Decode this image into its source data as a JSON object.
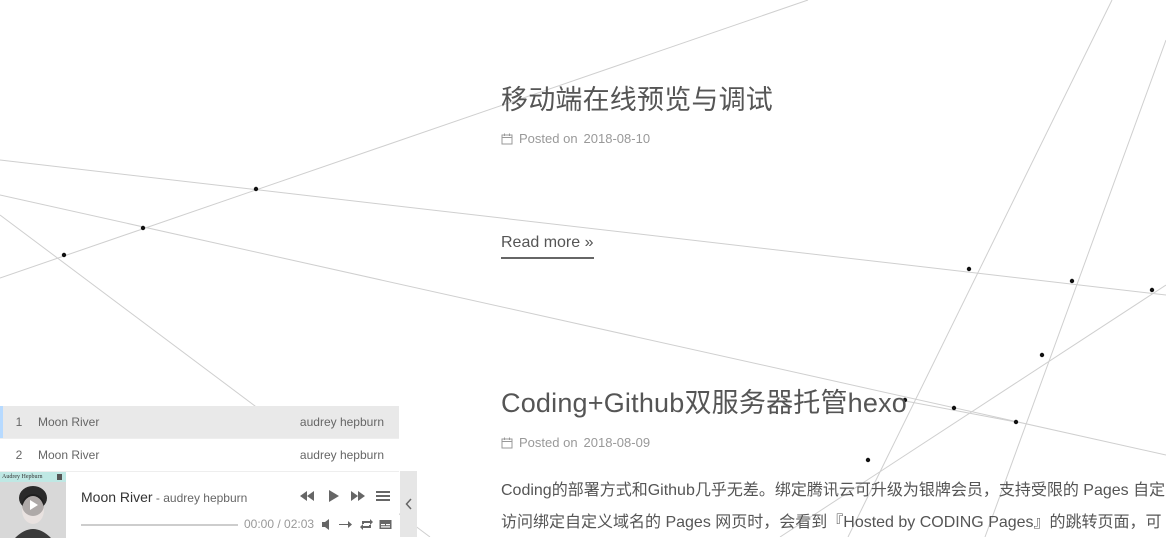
{
  "posts": [
    {
      "title": "移动端在线预览与调试",
      "meta_label": "Posted on",
      "date": "2018-08-10",
      "read_more": "Read more »"
    },
    {
      "title": "Coding+Github双服务器托管hexo",
      "meta_label": "Posted on",
      "date": "2018-08-09",
      "excerpt_lines": [
        "Coding的部署方式和Github几乎无差。绑定腾讯云可升级为银牌会员，支持受限的 Pages 自定",
        "访问绑定自定义域名的 Pages 网页时，会看到『Hosted by CODING Pages』的跳转页面，可"
      ]
    }
  ],
  "player": {
    "playlist": [
      {
        "index": "1",
        "title": "Moon River",
        "author": "audrey hepburn"
      },
      {
        "index": "2",
        "title": "Moon River",
        "author": "audrey hepburn"
      }
    ],
    "now_playing": {
      "title": "Moon River",
      "artist": " - audrey hepburn"
    },
    "cover_caption": "Audrey Hepburn",
    "time": "00:00 / 02:03",
    "progress": 0,
    "icons": [
      "skip-back-icon",
      "play-icon",
      "skip-forward-icon",
      "menu-icon",
      "volume-icon",
      "order-icon",
      "loop-icon",
      "lyrics-icon",
      "chevron-left-icon"
    ]
  },
  "colors": {
    "line": "#cccccc",
    "node": "#000000",
    "text": "#555555",
    "meta": "#999999",
    "playlist_active": "#e9e9e9"
  }
}
